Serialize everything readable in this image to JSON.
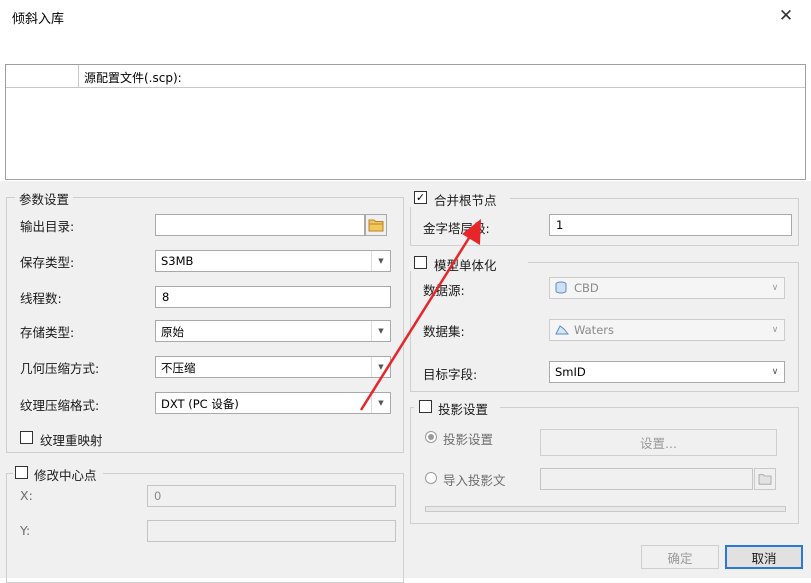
{
  "window": {
    "title": "倾斜入库",
    "close_icon": "close-icon"
  },
  "toolbar": {
    "icons": [
      "add-file-icon",
      "add-folder-icon",
      "delete-icon"
    ]
  },
  "file_list": {
    "column_header": "源配置文件(.scp):"
  },
  "params": {
    "title": "参数设置",
    "output_dir": {
      "label": "输出目录:",
      "value": ""
    },
    "save_type": {
      "label": "保存类型:",
      "value": "S3MB"
    },
    "threads": {
      "label": "线程数:",
      "value": "8"
    },
    "storage_type": {
      "label": "存储类型:",
      "value": "原始"
    },
    "geo_compress": {
      "label": "几何压缩方式:",
      "value": "不压缩"
    },
    "tex_compress": {
      "label": "纹理压缩格式:",
      "value": "DXT (PC 设备)"
    },
    "tex_remap": {
      "label": "纹理重映射",
      "checked": false
    }
  },
  "center": {
    "title": "修改中心点",
    "checked": false,
    "x": {
      "label": "X:",
      "value": "0"
    },
    "y": {
      "label": "Y:",
      "value": ""
    }
  },
  "merge": {
    "title": "合并根节点",
    "checked": true,
    "pyramid": {
      "label": "金字塔层级:",
      "value": "1"
    }
  },
  "singleton": {
    "title": "模型单体化",
    "checked": false,
    "datasource": {
      "label": "数据源:",
      "value": "CBD"
    },
    "dataset": {
      "label": "数据集:",
      "value": "Waters"
    },
    "field": {
      "label": "目标字段:",
      "value": "SmID"
    }
  },
  "projection": {
    "title": "投影设置",
    "checked": false,
    "opt_settings": {
      "label": "投影设置",
      "selected": true
    },
    "settings_button": "设置...",
    "opt_import": {
      "label": "导入投影文",
      "selected": false
    },
    "import_value": ""
  },
  "buttons": {
    "ok": "确定",
    "cancel": "取消"
  },
  "colors": {
    "annotation_arrow": "#e8262a",
    "panel_bg": "#f0f0f0",
    "default_button_border": "#2b79d0"
  }
}
